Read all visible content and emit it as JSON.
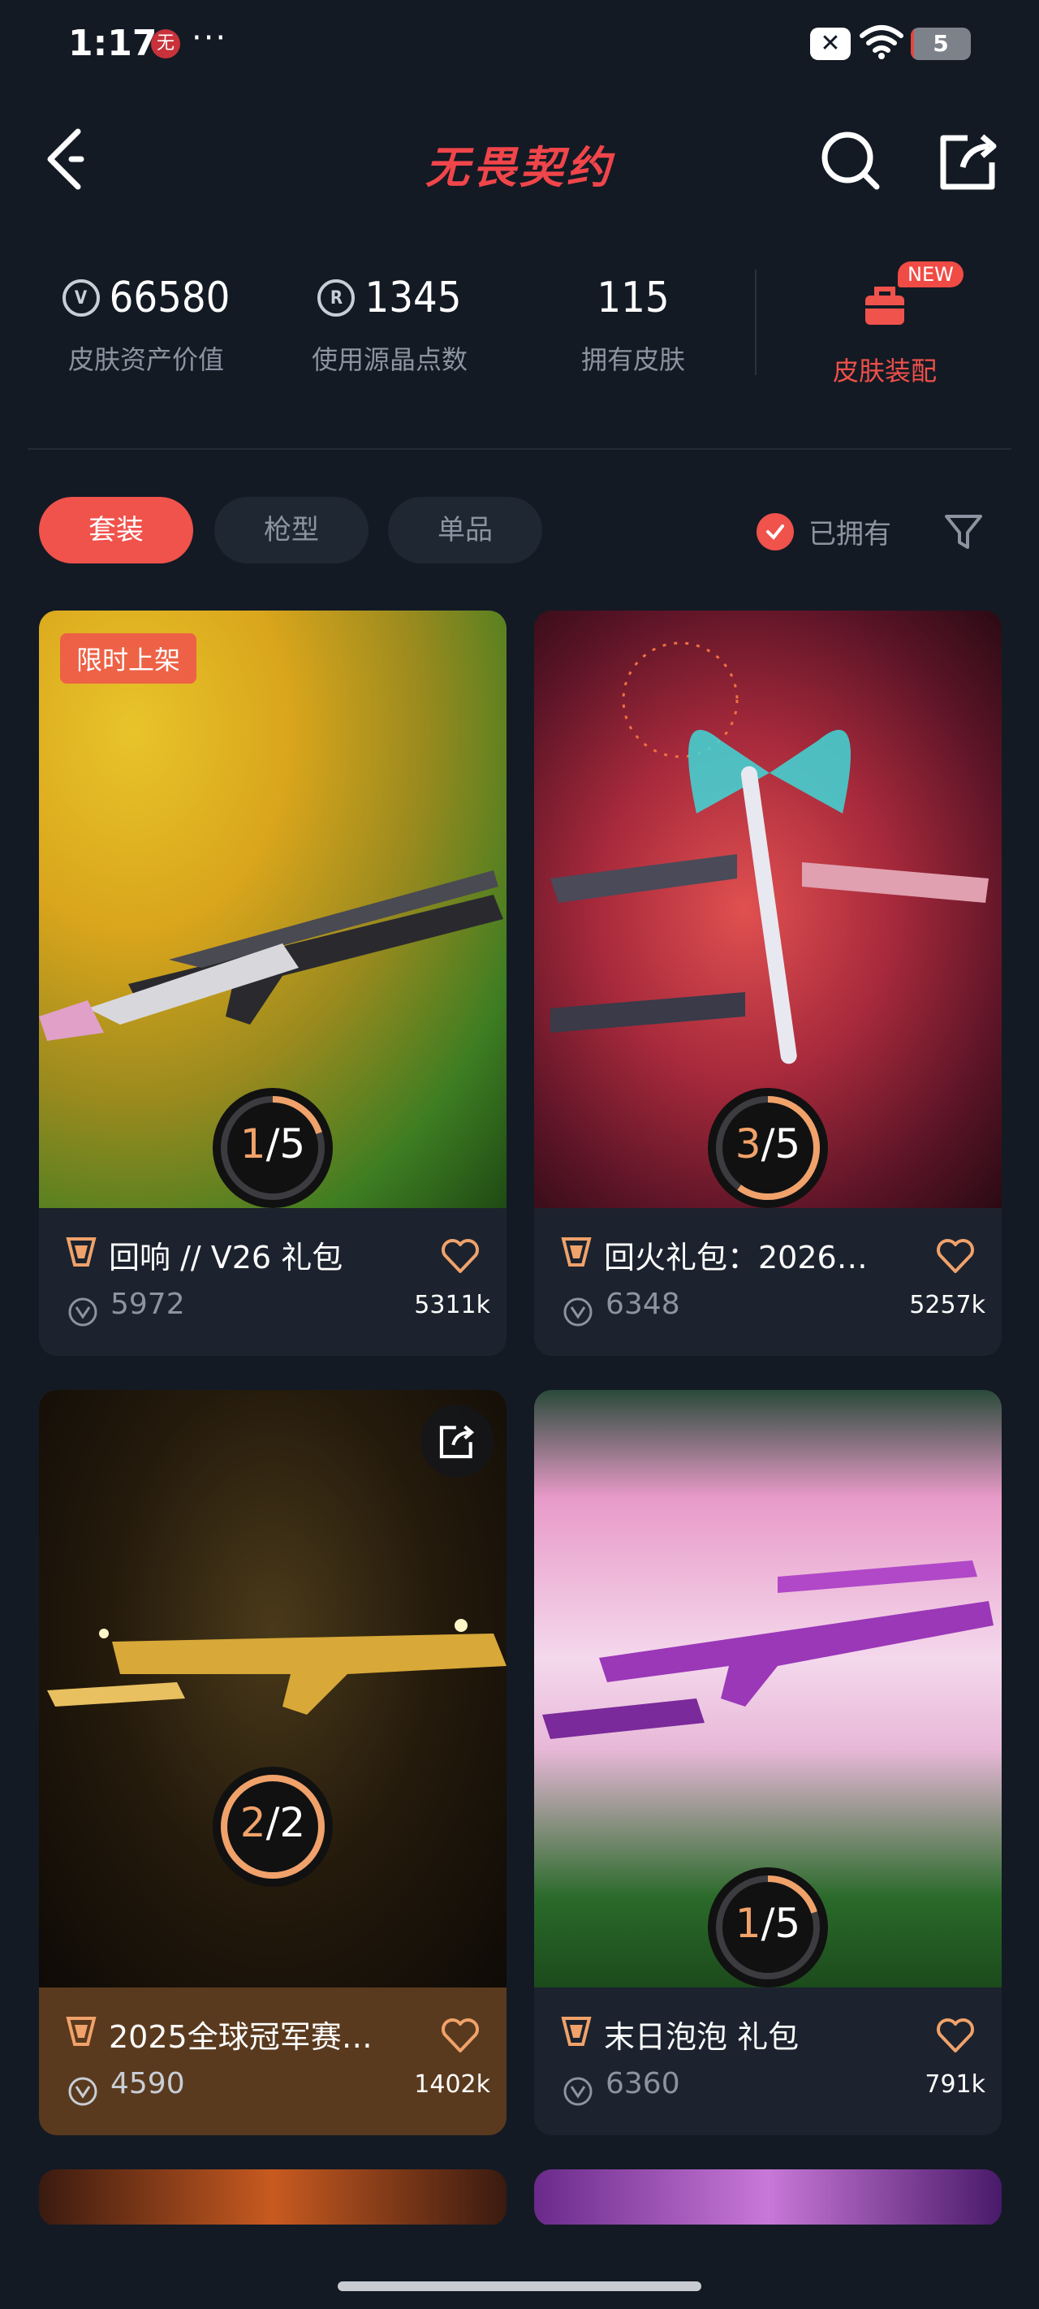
{
  "status_bar": {
    "time": "1:17",
    "app_glyph": "无",
    "more": "···",
    "notification": "✕",
    "battery": "5",
    "battery_level_percent": 5
  },
  "nav": {
    "title": "无畏契约"
  },
  "stats": {
    "asset_value": {
      "value": "66580",
      "label": "皮肤资产价值"
    },
    "radianite": {
      "value": "1345",
      "label": "使用源晶点数"
    },
    "owned": {
      "value": "115",
      "label": "拥有皮肤"
    },
    "equip": {
      "label": "皮肤装配",
      "badge": "NEW"
    }
  },
  "filters": {
    "tabs": [
      {
        "label": "套装"
      },
      {
        "label": "枪型"
      },
      {
        "label": "单品"
      }
    ],
    "owned_label": "已拥有"
  },
  "cards": [
    {
      "title": "回响 // V26 礼包",
      "price": "5972",
      "likes": "5311k",
      "owned": "1",
      "total": "5",
      "badge": "限时上架",
      "progress": 0.2
    },
    {
      "title": "回火礼包：2026…",
      "price": "6348",
      "likes": "5257k",
      "owned": "3",
      "total": "5",
      "progress": 0.6
    },
    {
      "title": "2025全球冠军赛…",
      "price": "4590",
      "likes": "1402k",
      "owned": "2",
      "total": "2",
      "progress": 1.0
    },
    {
      "title": "末日泡泡 礼包",
      "price": "6360",
      "likes": "791k",
      "owned": "1",
      "total": "5",
      "progress": 0.2
    }
  ],
  "colors": {
    "accent": "#f0524c",
    "progress": "#f0a26a",
    "background": "#131a24"
  }
}
